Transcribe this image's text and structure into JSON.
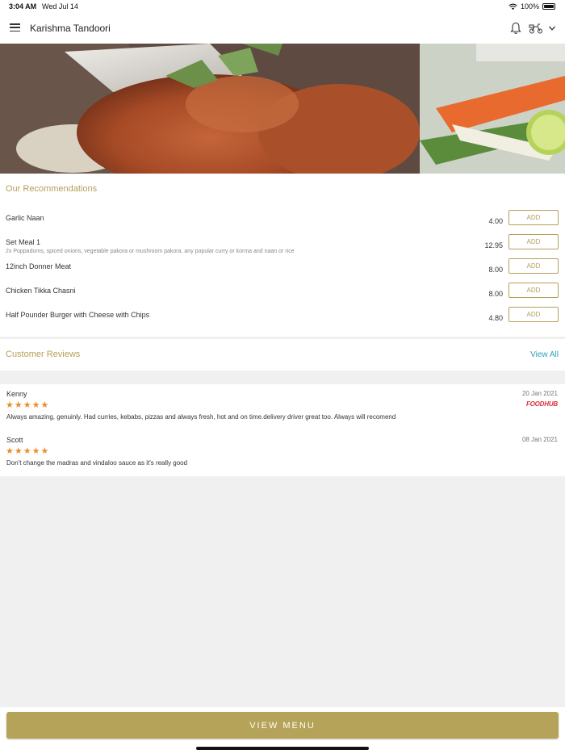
{
  "status": {
    "time": "3:04 AM",
    "date": "Wed Jul 14",
    "battery": "100%"
  },
  "header": {
    "title": "Karishma Tandoori"
  },
  "recommendations": {
    "title": "Our Recommendations",
    "add_label": "ADD",
    "items": [
      {
        "name": "Garlic Naan",
        "description": "",
        "price": "4.00"
      },
      {
        "name": "Set Meal 1",
        "description": "2x Poppadoms, spiced onions, vegetable pakora or mushroom pakora, any popular curry or korma and naan or rice",
        "price": "12.95"
      },
      {
        "name": "12inch Donner Meat",
        "description": "",
        "price": "8.00"
      },
      {
        "name": "Chicken Tikka Chasni",
        "description": "",
        "price": "8.00"
      },
      {
        "name": "Half Pounder Burger with Cheese with Chips",
        "description": "",
        "price": "4.80"
      }
    ]
  },
  "reviews": {
    "title": "Customer Reviews",
    "view_all": "View All",
    "items": [
      {
        "name": "Kenny",
        "date": "20 Jan 2021",
        "rating": 5,
        "stars": "★★★★★",
        "source": "FOODHUB",
        "text": "Always amazing, genuinly. Had curries, kebabs, pizzas and always fresh, hot and on time.delivery driver great too. Always will recomend"
      },
      {
        "name": "Scott",
        "date": "08 Jan 2021",
        "rating": 5,
        "stars": "★★★★★",
        "source": "",
        "text": "Don't change the madras and vindaloo sauce as it's really good"
      }
    ]
  },
  "footer": {
    "view_menu_label": "VIEW MENU"
  },
  "colors": {
    "accent": "#b4a358",
    "link": "#2e9ec1",
    "star": "#e88f2e",
    "foodhub": "#d6303e"
  },
  "icons": {
    "menu": "hamburger-icon",
    "bell": "bell-icon",
    "delivery": "scooter-icon",
    "chevron": "chevron-down-icon",
    "wifi": "wifi-icon",
    "battery": "battery-icon"
  }
}
